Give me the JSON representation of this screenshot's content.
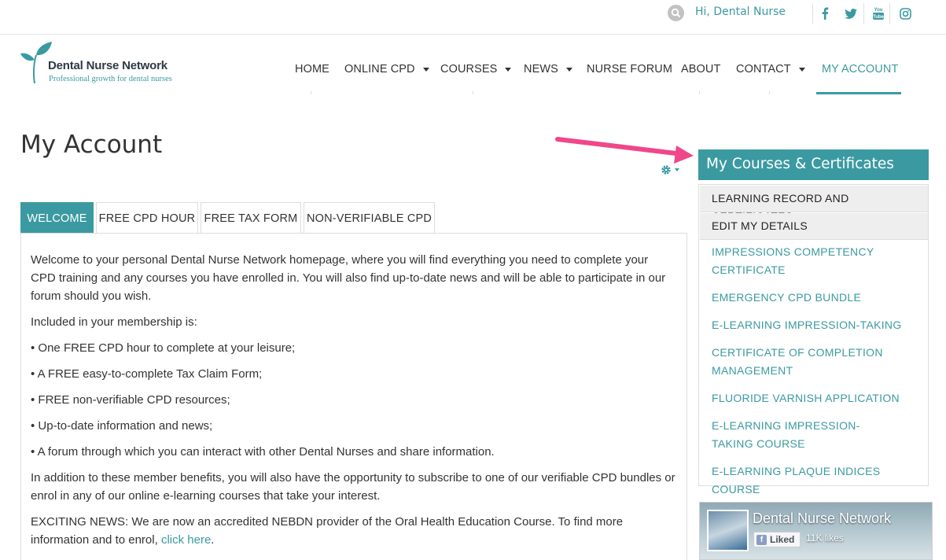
{
  "topbar": {
    "greeting": "Hi, Dental Nurse",
    "social_icons": [
      "facebook-icon",
      "twitter-icon",
      "youtube-icon",
      "instagram-icon"
    ],
    "youtube_label": "You Tube"
  },
  "logo": {
    "title": "Dental Nurse Network",
    "tagline": "Professional growth for dental nurses"
  },
  "nav": {
    "items": [
      {
        "label": "HOME"
      },
      {
        "label": "ONLINE CPD"
      },
      {
        "label": "COURSES"
      },
      {
        "label": "NEWS"
      },
      {
        "label": "NURSE FORUM"
      },
      {
        "label": "ABOUT"
      },
      {
        "label": "CONTACT"
      },
      {
        "label": "MY ACCOUNT"
      }
    ]
  },
  "page": {
    "title": "My Account"
  },
  "tabs": [
    {
      "label": "WELCOME"
    },
    {
      "label": "FREE CPD HOUR"
    },
    {
      "label": "FREE TAX FORM"
    },
    {
      "label": "NON-VERIFIABLE CPD"
    }
  ],
  "content": {
    "intro": "Welcome to your personal Dental Nurse Network homepage, where you will find everything you need to complete your CPD training and any courses you have enrolled in. You will also find up-to-date news and will be able to participate in our forum should you wish.",
    "included_heading": "Included in your membership is:",
    "benefits": [
      "• One FREE CPD hour to complete at your leisure;",
      "• A FREE easy-to-complete Tax Claim Form;",
      "• FREE non-verifiable CPD resources;",
      "• Up-to-date information and news;",
      "• A forum through which you can interact with other Dental Nurses and share information."
    ],
    "addition": "In addition to these member benefits, you will also have the opportunity to subscribe to one of our verifiable CPD bundles or enrol in any of our online e-learning courses that take your interest.",
    "news_text": "EXCITING NEWS: We are now an accredited NEBDN provider of the Oral Health Education Course. To find more information and to enrol, ",
    "news_link": "click here",
    "news_end": "."
  },
  "sidebar": {
    "heading": "My Courses & Certificates",
    "items": [
      {
        "label": "LEARNING RECORD AND CERTIFICATES"
      },
      {
        "label": "EDIT MY DETAILS"
      },
      {
        "label": "IMPRESSIONS COMPETENCY CERTIFICATE"
      },
      {
        "label": "EMERGENCY CPD BUNDLE"
      },
      {
        "label": "E-LEARNING IMPRESSION-TAKING"
      },
      {
        "label": "CERTIFICATE OF COMPLETION MANAGEMENT"
      },
      {
        "label": "FLUORIDE VARNISH APPLICATION"
      },
      {
        "label": "E-LEARNING IMPRESSION-TAKING COURSE"
      },
      {
        "label": "E-LEARNING PLAQUE INDICES COURSE"
      }
    ]
  },
  "facebook": {
    "page_name": "Dental Nurse Network",
    "liked_label": "Liked",
    "likes": "11K likes"
  },
  "colors": {
    "accent": "#3b9aa1",
    "arrow": "#f0478a"
  }
}
